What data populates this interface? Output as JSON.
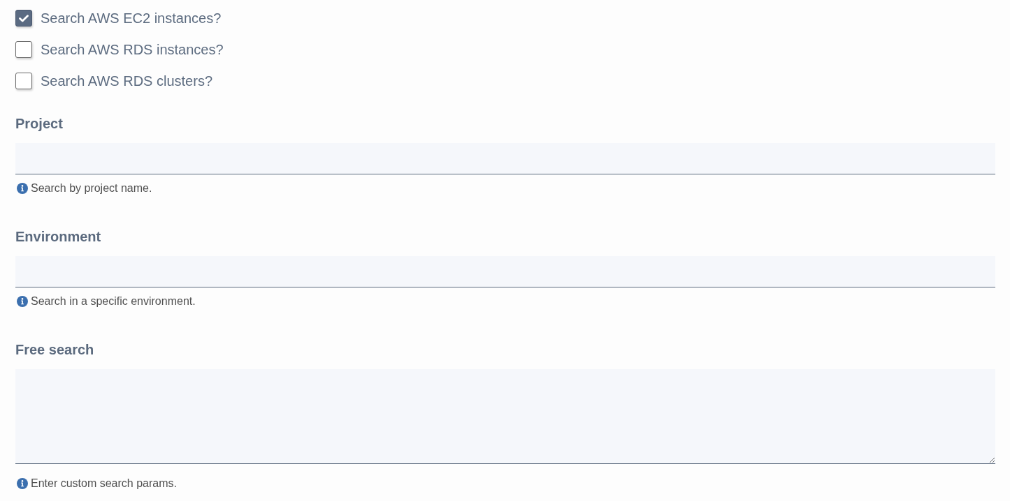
{
  "checkboxes": [
    {
      "label": "Search AWS EC2 instances?",
      "checked": true
    },
    {
      "label": "Search AWS RDS instances?",
      "checked": false
    },
    {
      "label": "Search AWS RDS clusters?",
      "checked": false
    }
  ],
  "fields": [
    {
      "label": "Project",
      "kind": "input",
      "help": "Search by project name."
    },
    {
      "label": "Environment",
      "kind": "input",
      "help": "Search in a specific environment."
    },
    {
      "label": "Free search",
      "kind": "textarea",
      "help": "Enter custom search params."
    }
  ]
}
